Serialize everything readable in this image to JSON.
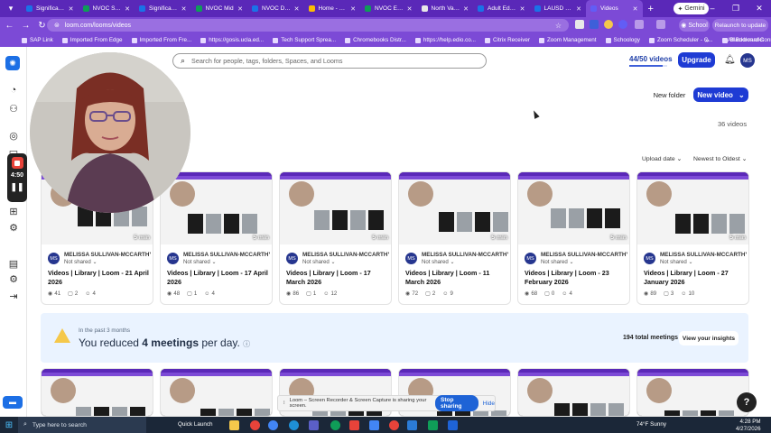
{
  "browser": {
    "tabs": [
      {
        "label": "Significant C",
        "active": false,
        "color": "#1a73e8"
      },
      {
        "label": "NVOC Staff",
        "active": false,
        "color": "#0f9d58"
      },
      {
        "label": "Significant C",
        "active": false,
        "color": "#1a73e8"
      },
      {
        "label": "NVOC Mid",
        "active": false,
        "color": "#0f9d58"
      },
      {
        "label": "NVOC Desc",
        "active": false,
        "color": "#1a73e8"
      },
      {
        "label": "Home - Goo",
        "active": false,
        "color": "#fbbc04"
      },
      {
        "label": "NVOC EMPL",
        "active": false,
        "color": "#0f9d58"
      },
      {
        "label": "North Valley",
        "active": false,
        "color": "#e8e8e8"
      },
      {
        "label": "Adult Ed. Fo",
        "active": false,
        "color": "#1a73e8"
      },
      {
        "label": "LAUSD Class",
        "active": false,
        "color": "#1a73e8"
      },
      {
        "label": "Videos",
        "active": true,
        "color": "#625df5"
      }
    ],
    "gemini_label": "Gemini",
    "url": "loom.com/looms/videos",
    "profile_label": "School",
    "relaunch_label": "Relaunch to update",
    "bookmarks": [
      "SAP Link",
      "Imported From Edge",
      "Imported From Fre...",
      "https://gosis.ucla.ed...",
      "Tech Support Sprea...",
      "Chromebooks Distr...",
      "https://help.edio.co...",
      "Citrix Receiver",
      "Zoom Management",
      "Schoology",
      "Zoom Scheduler - C...",
      "Blackboard Connect"
    ],
    "all_bookmarks_label": "All Bookmarks"
  },
  "header": {
    "search_placeholder": "Search for people, tags, folders, Spaces, and Looms",
    "quota_label": "44/50 videos",
    "quota_fraction": 0.88,
    "upgrade_label": "Upgrade",
    "avatar_initials": "MS",
    "new_folder_label": "New folder",
    "new_video_label": "New video",
    "video_count": "36 videos",
    "sort_by_label": "Upload date",
    "sort_order_label": "Newest to Oldest"
  },
  "recorder": {
    "time": "4:50"
  },
  "videos": [
    {
      "author": "MELISSA SULLIVAN-MCCARTHY",
      "initials": "MS",
      "sharing": "Not shared",
      "title": "Videos | Library | Loom - 21 April 2026",
      "duration": "5 min",
      "views": "41",
      "comments": "2",
      "reactions": "4"
    },
    {
      "author": "MELISSA SULLIVAN-MCCARTHY",
      "initials": "MS",
      "sharing": "Not shared",
      "title": "Videos | Library | Loom - 17 April 2026",
      "duration": "5 min",
      "views": "48",
      "comments": "1",
      "reactions": "4"
    },
    {
      "author": "MELISSA SULLIVAN-MCCARTHY",
      "initials": "MS",
      "sharing": "Not shared",
      "title": "Videos | Library | Loom - 17 March 2026",
      "duration": "5 min",
      "views": "86",
      "comments": "1",
      "reactions": "12"
    },
    {
      "author": "MELISSA SULLIVAN-MCCARTHY",
      "initials": "MS",
      "sharing": "Not shared",
      "title": "Videos | Library | Loom - 11 March 2026",
      "duration": "5 min",
      "views": "72",
      "comments": "2",
      "reactions": "9"
    },
    {
      "author": "MELISSA SULLIVAN-MCCARTHY",
      "initials": "MS",
      "sharing": "Not shared",
      "title": "Videos | Library | Loom - 23 February 2026",
      "duration": "5 min",
      "views": "68",
      "comments": "0",
      "reactions": "4"
    },
    {
      "author": "MELISSA SULLIVAN-MCCARTHY",
      "initials": "MS",
      "sharing": "Not shared",
      "title": "Videos | Library | Loom - 27 January 2026",
      "duration": "5 min",
      "views": "89",
      "comments": "3",
      "reactions": "10"
    }
  ],
  "insights": {
    "period": "In the past 3 months",
    "prefix": "You reduced",
    "highlight": "4 meetings",
    "suffix": "per day.",
    "total": "194 total meetings",
    "button_label": "View your insights"
  },
  "sharing_bar": {
    "text": "Loom – Screen Recorder & Screen Capture is sharing your screen.",
    "stop_label": "Stop sharing",
    "hide_label": "Hide"
  },
  "taskbar": {
    "search_placeholder": "Type here to search",
    "quick_launch": "Quick Launch",
    "weather": "74°F Sunny",
    "time": "4:28 PM",
    "date": "4/27/2026"
  }
}
